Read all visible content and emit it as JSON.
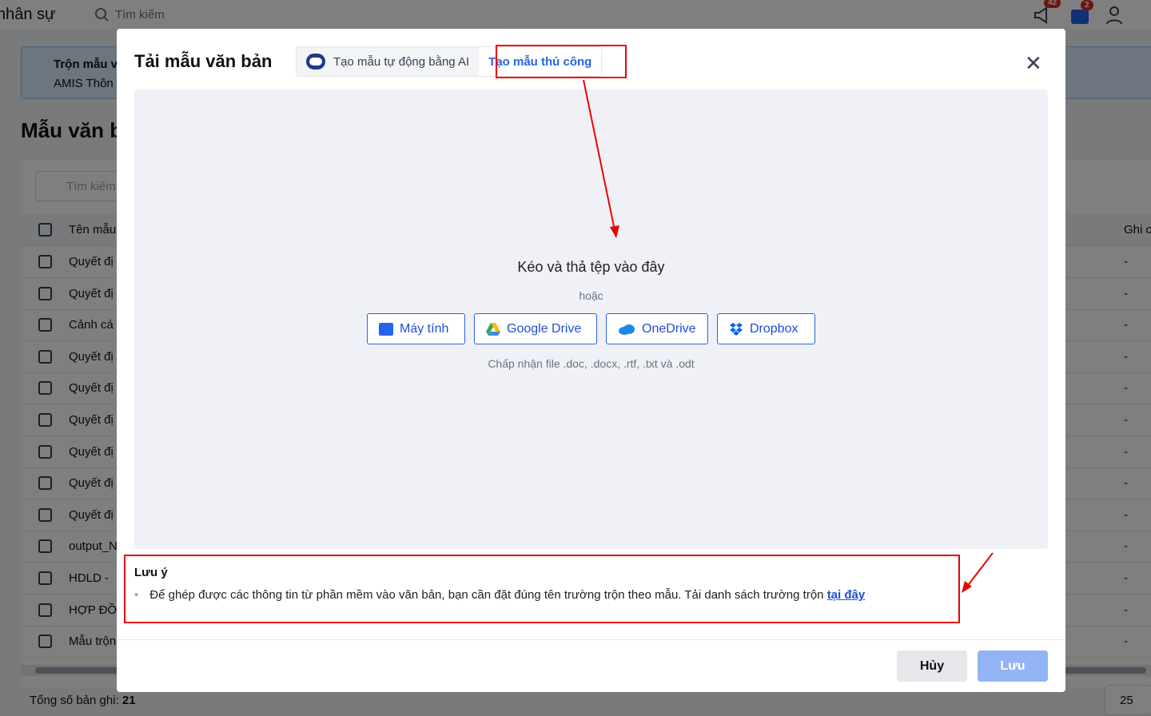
{
  "topbar": {
    "app_title": "nhân sự",
    "search_placeholder": "Tìm kiếm",
    "badge_notify": "42",
    "badge_cart": "2"
  },
  "banner": {
    "line1": "Trộn mẫu v",
    "line2": "AMIS Thôn"
  },
  "page": {
    "title": "Mẫu văn b",
    "search_placeholder": "Tìm kiếm",
    "col_name": "Tên mẫu",
    "col_note": "Ghi c"
  },
  "rows": [
    "Quyết đị",
    "Quyết đị",
    "Cảnh cá",
    "Quyết đị",
    "Quyết đị",
    "Quyết đị",
    "Quyết đị",
    "Quyết đị",
    "Quyết đị",
    "output_N",
    "HDLD - ",
    "HỢP ĐỒ",
    "Mẫu trộn"
  ],
  "row_dash": "-",
  "footer": {
    "total_label": "Tổng số bản ghi:",
    "total_value": "21",
    "page_size": "25"
  },
  "modal": {
    "title": "Tải mẫu văn bản",
    "tab_ai": "Tạo mẫu tự động bằng AI",
    "tab_manual": "Tạo mẫu thủ công",
    "drop_title": "Kéo và thả tệp vào đây",
    "drop_or": "hoặc",
    "sources": [
      "Máy tính",
      "Google Drive",
      "OneDrive",
      "Dropbox"
    ],
    "accept_note": "Chấp nhận file .doc, .docx, .rtf, .txt và .odt",
    "note_title": "Lưu ý",
    "note_text": "Để ghép được các thông tin từ phần mềm vào văn bản, bạn cần đặt đúng tên trường trộn theo mẫu. Tải danh sách trường trộn",
    "note_link": "tại đây",
    "cancel": "Hủy",
    "save": "Lưu"
  },
  "colors": {
    "accent": "#2563eb",
    "highlight": "#e00000"
  }
}
